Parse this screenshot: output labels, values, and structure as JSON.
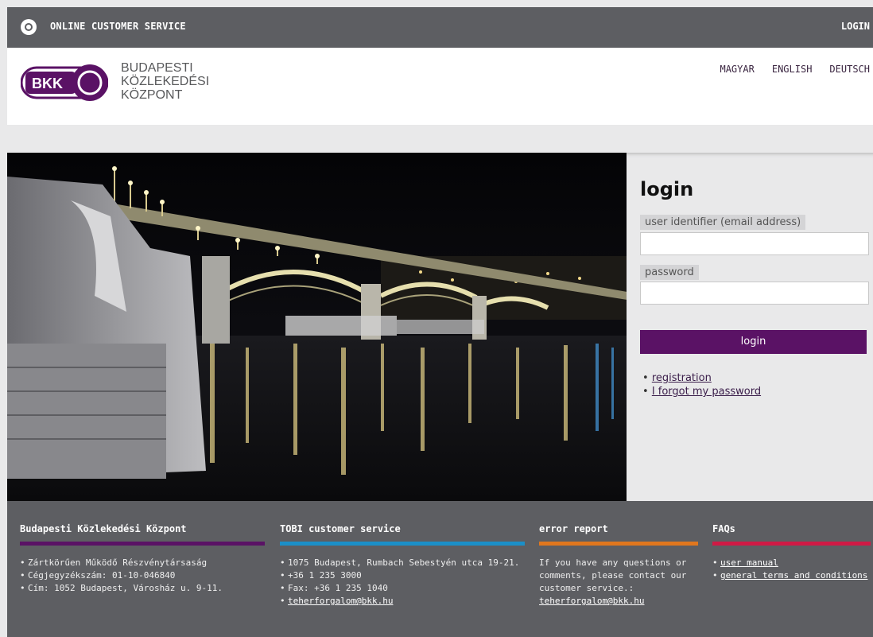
{
  "topbar": {
    "title": "ONLINE CUSTOMER SERVICE",
    "login": "LOGIN"
  },
  "header": {
    "logo_text": "BKK",
    "logo_name_lines": [
      "BUDAPESTI",
      "KÖZLEKEDÉSI",
      "KÖZPONT"
    ],
    "languages": [
      "MAGYAR",
      "ENGLISH",
      "DEUTSCH"
    ]
  },
  "login": {
    "title": "login",
    "user_label": "user identifier (email address)",
    "user_value": "",
    "password_label": "password",
    "password_value": "",
    "button": "login",
    "links": [
      "registration",
      "I forgot my password"
    ]
  },
  "footer": {
    "col1": {
      "title": "Budapesti Közlekedési Központ",
      "bar_color": "#5a1265",
      "items": [
        "Zártkörűen Működő Részvénytársaság",
        "Cégjegyzékszám: 01-10-046840",
        "Cím: 1052 Budapest, Városház u. 9-11."
      ]
    },
    "col2": {
      "title": "TOBI customer service",
      "bar_color": "#1b8fc8",
      "items": [
        "1075 Budapest, Rumbach Sebestyén utca 19-21.",
        "+36 1 235 3000",
        "Fax: +36 1 235 1040"
      ],
      "email": "teherforgalom@bkk.hu"
    },
    "col3": {
      "title": "error report",
      "bar_color": "#e0771e",
      "text": "If you have any questions or comments, please contact our customer service.:",
      "email": "teherforgalom@bkk.hu"
    },
    "col4": {
      "title": "FAQs",
      "bar_color": "#cf1a45",
      "links": [
        "user manual",
        "general terms and conditions"
      ]
    }
  },
  "colors": {
    "brand_purple": "#5a1265",
    "topbar_gray": "#5d5e62"
  }
}
